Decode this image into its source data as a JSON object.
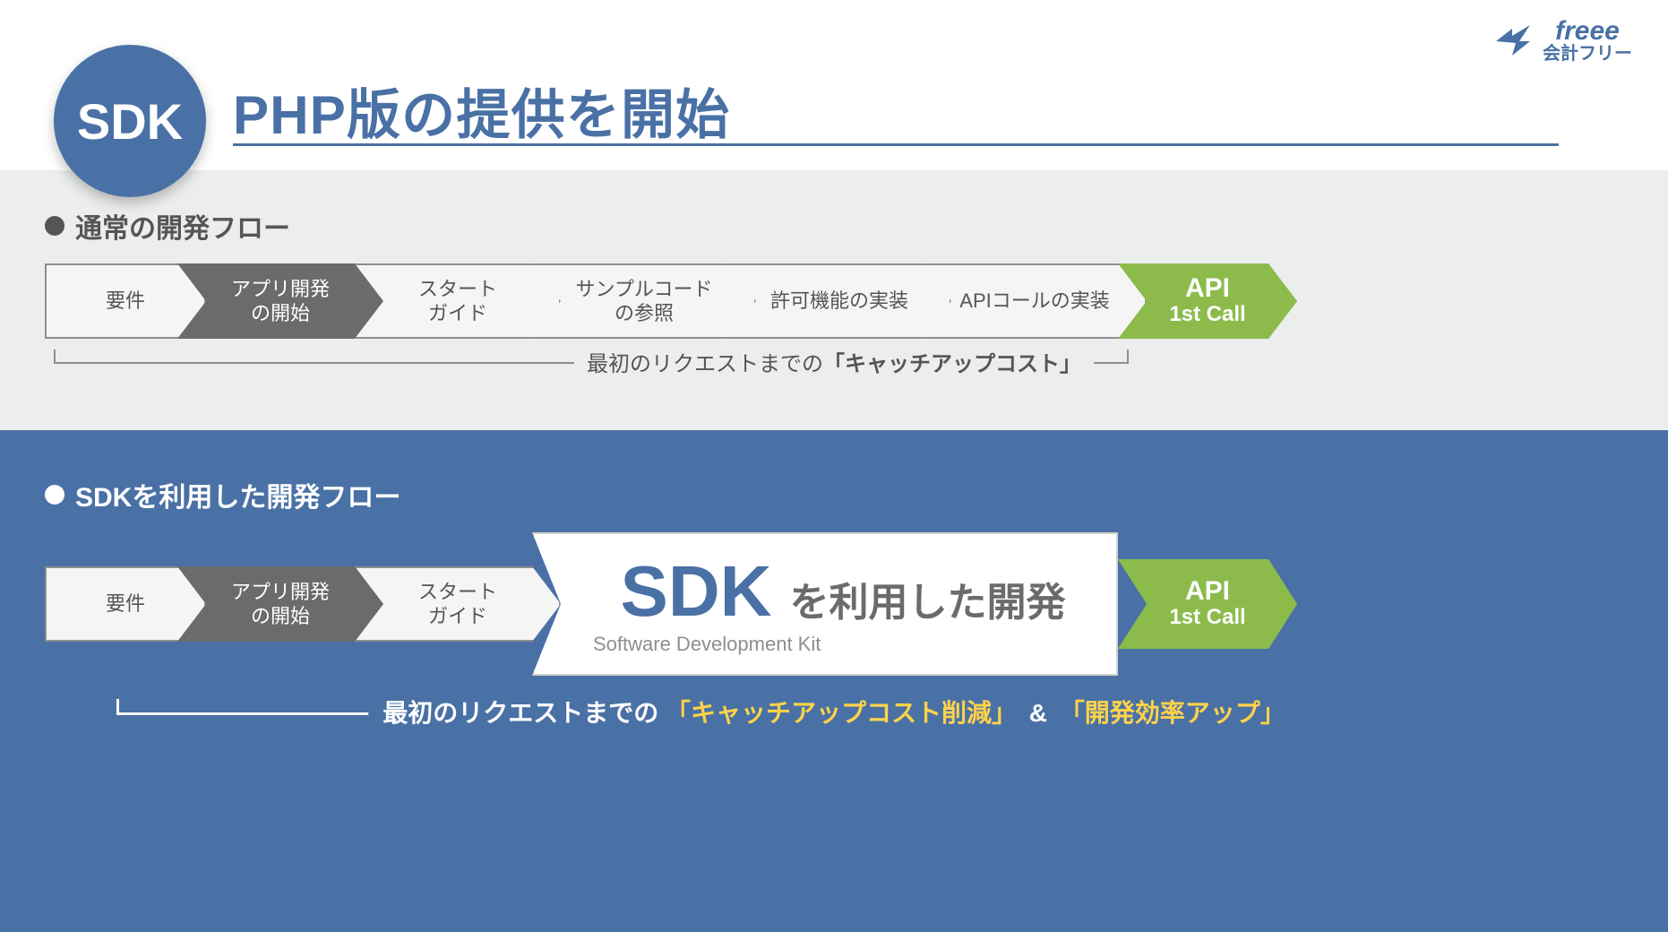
{
  "header": {
    "badge": "SDK",
    "title": "PHP版の提供を開始",
    "logo_script": "freee",
    "logo_sub": "会計フリー"
  },
  "section1": {
    "label": "通常の開発フロー",
    "steps": [
      "要件",
      "アプリ開発\nの開始",
      "スタート\nガイド",
      "サンプルコード\nの参照",
      "許可機能の実装",
      "APIコールの実装"
    ],
    "goal_top": "API",
    "goal_bottom": "1st Call",
    "bracket_prefix": "最初のリクエストまでの",
    "bracket_strong": "「キャッチアップコスト」"
  },
  "section2": {
    "label": "SDKを利用した開発フロー",
    "steps": [
      "要件",
      "アプリ開発\nの開始",
      "スタート\nガイド"
    ],
    "sdk_big": "SDK",
    "sdk_rest": "を利用した開発",
    "sdk_sub": "Software Development Kit",
    "goal_top": "API",
    "goal_bottom": "1st Call",
    "bracket_prefix": "最初のリクエストまでの",
    "bracket_accent1": "「キャッチアップコスト削減」",
    "bracket_amp": "&",
    "bracket_accent2": "「開発効率アップ」"
  },
  "chart_data": {
    "type": "table",
    "title": "SDK PHP版の提供を開始 — 開発フロー比較",
    "flows": [
      {
        "name": "通常の開発フロー",
        "steps": [
          "要件",
          "アプリ開発の開始",
          "スタートガイド",
          "サンプルコードの参照",
          "許可機能の実装",
          "APIコールの実装",
          "API 1st Call"
        ],
        "note": "最初のリクエストまでの「キャッチアップコスト」"
      },
      {
        "name": "SDKを利用した開発フロー",
        "steps": [
          "要件",
          "アプリ開発の開始",
          "スタートガイド",
          "SDK (Software Development Kit) を利用した開発",
          "API 1st Call"
        ],
        "note": "最初のリクエストまでの「キャッチアップコスト削減」&「開発効率アップ」"
      }
    ]
  }
}
